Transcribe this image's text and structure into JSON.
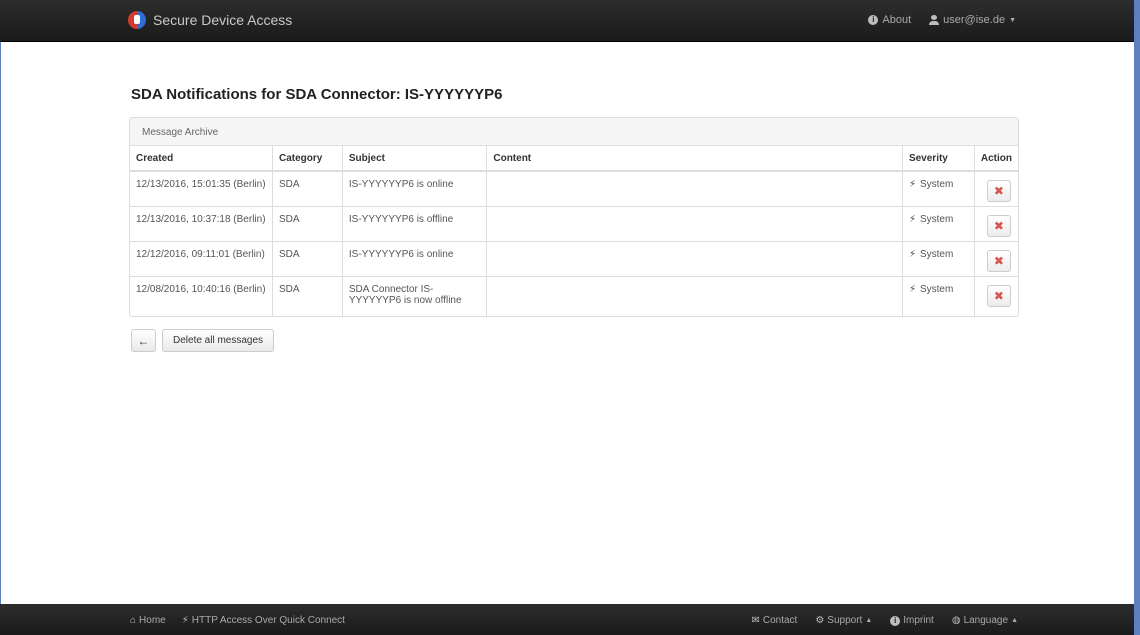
{
  "app": {
    "brand_title": "Secure Device Access",
    "nav": {
      "about_label": "About",
      "user_label": "user@ise.de"
    }
  },
  "page": {
    "title": "SDA Notifications for SDA Connector: IS-YYYYYYP6"
  },
  "archive": {
    "panel_title": "Message Archive",
    "columns": [
      "Created",
      "Category",
      "Subject",
      "Content",
      "Severity",
      "Action"
    ],
    "rows": [
      {
        "created": "12/13/2016, 15:01:35 (Berlin)",
        "category": "SDA",
        "subject": "IS-YYYYYYP6 is online",
        "content": "",
        "severity": "System"
      },
      {
        "created": "12/13/2016, 10:37:18 (Berlin)",
        "category": "SDA",
        "subject": "IS-YYYYYYP6 is offline",
        "content": "",
        "severity": "System"
      },
      {
        "created": "12/12/2016, 09:11:01 (Berlin)",
        "category": "SDA",
        "subject": "IS-YYYYYYP6 is online",
        "content": "",
        "severity": "System"
      },
      {
        "created": "12/08/2016, 10:40:16 (Berlin)",
        "category": "SDA",
        "subject": "SDA Connector IS-YYYYYYP6 is now offline",
        "content": "",
        "severity": "System"
      }
    ],
    "delete_glyph": "✖"
  },
  "actions": {
    "back_glyph": "←",
    "delete_all_label": "Delete all messages"
  },
  "footer": {
    "home_label": "Home",
    "quick_connect_label": "HTTP Access Over Quick Connect",
    "contact_label": "Contact",
    "support_label": "Support",
    "imprint_label": "Imprint",
    "language_label": "Language"
  },
  "colors": {
    "navbar": "#222222",
    "delete_accent": "#d9534f",
    "frame": "#5b7fbf"
  }
}
